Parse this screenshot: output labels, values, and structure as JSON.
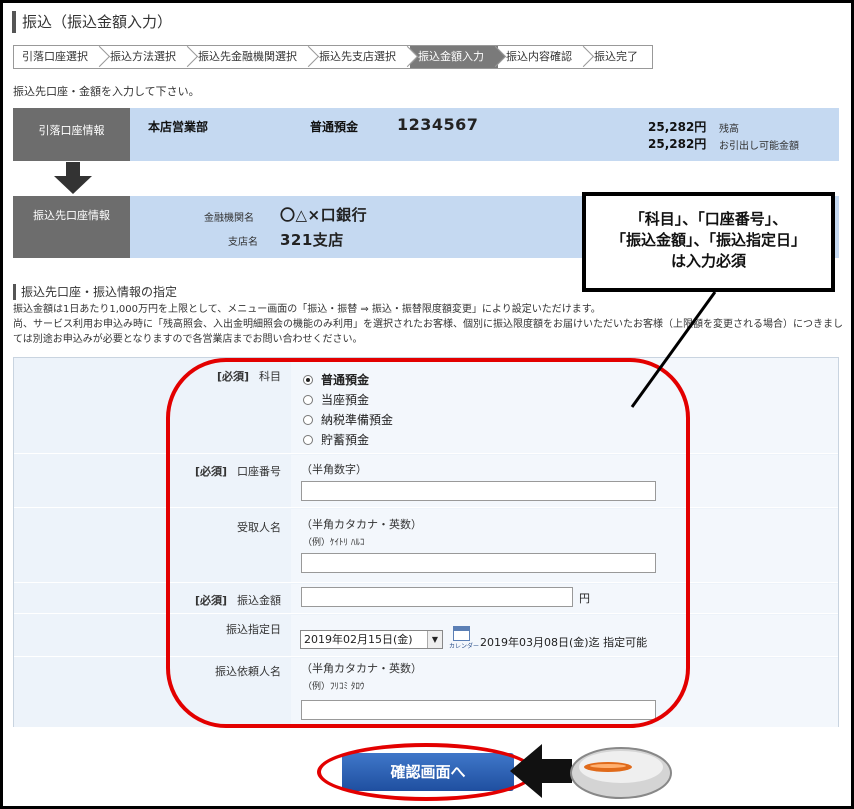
{
  "page": {
    "title": "振込（振込金額入力）"
  },
  "steps": [
    {
      "label": "引落口座選択",
      "active": false
    },
    {
      "label": "振込方法選択",
      "active": false
    },
    {
      "label": "振込先金融機関選択",
      "active": false
    },
    {
      "label": "振込先支店選択",
      "active": false
    },
    {
      "label": "振込金額入力",
      "active": true
    },
    {
      "label": "振込内容確認",
      "active": false
    },
    {
      "label": "振込完了",
      "active": false
    }
  ],
  "intro": "振込先口座・金額を入力して下さい。",
  "debit_account": {
    "label": "引落口座情報",
    "branch": "本店営業部",
    "type": "普通預金",
    "number": "1234567",
    "balance": "25,282円",
    "balance_label": "残高",
    "available": "25,282円",
    "available_label": "お引出し可能金額"
  },
  "payee_account": {
    "label": "振込先口座情報",
    "bank_label": "金融機関名",
    "bank": "〇△×口銀行",
    "branch_label": "支店名",
    "branch": "321支店"
  },
  "section": {
    "title": "振込先口座・振込情報の指定",
    "note1": "振込金額は1日あたり1,000万円を上限として、メニュー画面の「振込・振替 ⇒ 振込・振替限度額変更」により設定いただけます。",
    "note2": "尚、サービス利用お申込み時に「残高照会、入出金明細照会の機能のみ利用」を選択されたお客様、個別に振込限度額をお届けいただいたお客様（上限額を変更される場合）につきましては別途お申込みが必要となりますので各営業店までお問い合わせください。"
  },
  "form": {
    "required_tag": "[必須]",
    "subject": {
      "label": "科目",
      "options": [
        {
          "label": "普通預金",
          "selected": true
        },
        {
          "label": "当座預金",
          "selected": false
        },
        {
          "label": "納税準備預金",
          "selected": false
        },
        {
          "label": "貯蓄預金",
          "selected": false
        }
      ]
    },
    "account_number": {
      "label": "口座番号",
      "hint": "（半角数字）",
      "value": ""
    },
    "recipient": {
      "label": "受取人名",
      "hint": "（半角カタカナ・英数）",
      "example": "（例）ｹｲﾄﾘ ﾊﾙｺ",
      "value": ""
    },
    "amount": {
      "label": "振込金額",
      "unit": "円",
      "value": ""
    },
    "date": {
      "label": "振込指定日",
      "selected": "2019年02月15日(金)",
      "calendar_caption": "カレンダー",
      "limit_text": "2019年03月08日(金)迄 指定可能"
    },
    "requester": {
      "label": "振込依頼人名",
      "hint": "（半角カタカナ・英数）",
      "example": "（例）ﾌﾘｺﾐ ﾀﾛｳ",
      "value": ""
    }
  },
  "submit_label": "確認画面へ",
  "callout": {
    "line1": "「科目」、「口座番号」、",
    "line2": "「振込金額」、「振込指定日」",
    "line3": "は入力必須"
  },
  "colors": {
    "highlight": "#e30000",
    "band": "#c5d9f1",
    "label_bg": "#6d6d6d",
    "button": "#2b5fb3"
  }
}
